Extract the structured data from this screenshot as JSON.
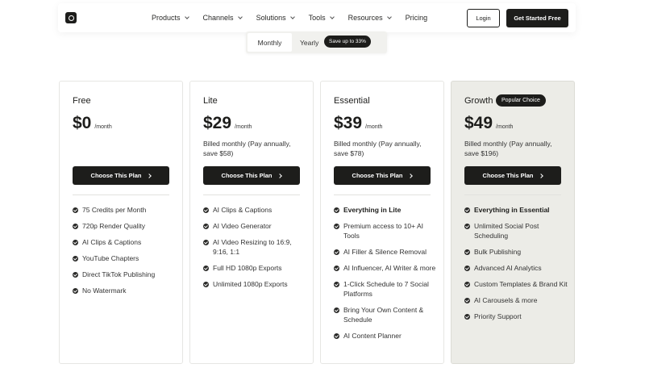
{
  "nav": {
    "logo": "logo-icon",
    "menu": [
      {
        "label": "Products",
        "dropdown": true
      },
      {
        "label": "Channels",
        "dropdown": true
      },
      {
        "label": "Solutions",
        "dropdown": true
      },
      {
        "label": "Tools",
        "dropdown": true
      },
      {
        "label": "Resources",
        "dropdown": true
      },
      {
        "label": "Pricing",
        "dropdown": false
      }
    ],
    "login": "Login",
    "cta": "Get Started Free"
  },
  "billing": {
    "monthly": "Monthly",
    "yearly": "Yearly",
    "save_badge": "Save up to 33%",
    "selected": "Monthly"
  },
  "plans": [
    {
      "name": "Free",
      "price": "$0",
      "period": "/month",
      "billed": "",
      "cta": "Choose This Plan",
      "featured": false,
      "badge": "",
      "features": [
        {
          "text": "75 Credits per Month",
          "bold": false
        },
        {
          "text": "720p Render Quality",
          "bold": false
        },
        {
          "text": "AI Clips & Captions",
          "bold": false
        },
        {
          "text": "YouTube Chapters",
          "bold": false
        },
        {
          "text": "Direct TikTok Publishing",
          "bold": false
        },
        {
          "text": "No Watermark",
          "bold": false
        }
      ]
    },
    {
      "name": "Lite",
      "price": "$29",
      "period": "/month",
      "billed": "Billed monthly (Pay annually, save $58)",
      "cta": "Choose This Plan",
      "featured": false,
      "badge": "",
      "features": [
        {
          "text": "AI Clips & Captions",
          "bold": false
        },
        {
          "text": "AI Video Generator",
          "bold": false
        },
        {
          "text": "AI Video Resizing to 16:9, 9:16, 1:1",
          "bold": false
        },
        {
          "text": "Full HD 1080p Exports",
          "bold": false
        },
        {
          "text": "Unlimited 1080p Exports",
          "bold": false
        }
      ]
    },
    {
      "name": "Essential",
      "price": "$39",
      "period": "/month",
      "billed": "Billed monthly (Pay annually, save $78)",
      "cta": "Choose This Plan",
      "featured": false,
      "badge": "",
      "features": [
        {
          "text": "Everything in Lite",
          "bold": true
        },
        {
          "text": "Premium access to 10+ AI Tools",
          "bold": false
        },
        {
          "text": "AI Filler & Silence Removal",
          "bold": false
        },
        {
          "text": "AI Influencer, AI Writer & more",
          "bold": false
        },
        {
          "text": "1-Click Schedule to 7 Social Platforms",
          "bold": false
        },
        {
          "text": "Bring Your Own Content & Schedule",
          "bold": false
        },
        {
          "text": "AI Content Planner",
          "bold": false
        }
      ]
    },
    {
      "name": "Growth",
      "price": "$49",
      "period": "/month",
      "billed": "Billed monthly (Pay annually, save $196)",
      "cta": "Choose This Plan",
      "featured": true,
      "badge": "Popular Choice",
      "features": [
        {
          "text": "Everything in Essential",
          "bold": true
        },
        {
          "text": "Unlimited Social Post Scheduling",
          "bold": false
        },
        {
          "text": "Bulk Publishing",
          "bold": false
        },
        {
          "text": "Advanced AI Analytics",
          "bold": false
        },
        {
          "text": "Custom Templates & Brand Kit",
          "bold": false
        },
        {
          "text": "AI Carousels & more",
          "bold": false
        },
        {
          "text": "Priority Support",
          "bold": false
        }
      ]
    }
  ]
}
